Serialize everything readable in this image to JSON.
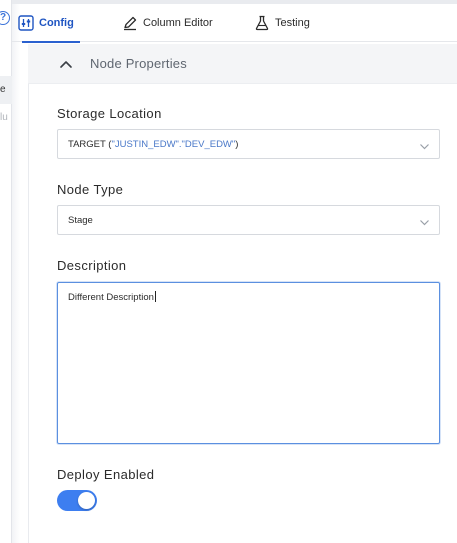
{
  "left_panel": {
    "help_glyph": "?",
    "row1_fragment": "e",
    "row2_fragment": "lu"
  },
  "tabs": [
    {
      "label": "Config",
      "icon": "sliders-icon",
      "active": true
    },
    {
      "label": "Column Editor",
      "icon": "pencil-icon",
      "active": false
    },
    {
      "label": "Testing",
      "icon": "flask-icon",
      "active": false
    }
  ],
  "section": {
    "title": "Node Properties",
    "expanded": true,
    "icon": "chevron-up-icon"
  },
  "form": {
    "storage_location": {
      "label": "Storage Location",
      "value_prefix": "TARGET (",
      "value_quoted": "\"JUSTIN_EDW\".\"DEV_EDW\"",
      "value_suffix": ")"
    },
    "node_type": {
      "label": "Node Type",
      "value": "Stage"
    },
    "description": {
      "label": "Description",
      "value": "Different Description"
    },
    "deploy_enabled": {
      "label": "Deploy Enabled",
      "enabled": true
    }
  },
  "colors": {
    "accent": "#2a60cf",
    "toggle_on": "#3d7ef0",
    "focus_border": "#5b90e0",
    "quoted_value": "#4a78c8"
  }
}
